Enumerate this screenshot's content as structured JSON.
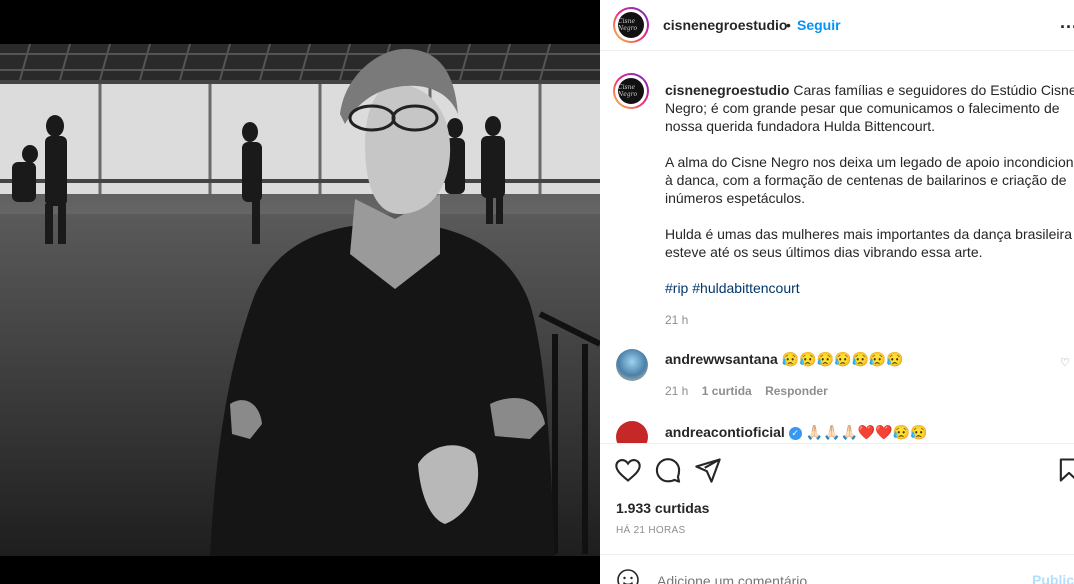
{
  "post": {
    "username": "cisnenegroestudio",
    "follow_label": "Seguir",
    "separator": "•",
    "more_label": "...",
    "avatar_text": "Cisne Negro",
    "caption_paragraphs": [
      "Caras famílias e seguidores do Estúdio Cisne Negro; é com grande pesar que comunicamos o falecimento de nossa querida fundadora Hulda Bittencourt.",
      "A alma do Cisne Negro nos deixa um legado de apoio incondicional à danca, com a formação de centenas de bailarinos e criação de inúmeros espetáculos.",
      "Hulda é umas das mulheres mais importantes da dança brasileira e esteve até os seus últimos dias vibrando essa arte."
    ],
    "hashtags": [
      "#rip",
      "#huldabittencourt"
    ],
    "caption_time": "21 h"
  },
  "comments": [
    {
      "username": "andrewwsantana",
      "text": "😥😥😥😥😥😥😥",
      "time": "21 h",
      "likes": "1 curtida",
      "reply": "Responder"
    },
    {
      "username": "andreacontioficial",
      "text": "🙏🏻🙏🏻🙏🏻❤️❤️😥😥",
      "verified": true
    }
  ],
  "footer": {
    "likes": "1.933 curtidas",
    "date": "HÁ 21 HORAS",
    "comment_placeholder": "Adicione um comentário...",
    "publish_label": "Publicar"
  },
  "colors": {
    "accent": "#0095f6",
    "hashtag": "#00376b",
    "muted": "#8e8e8e"
  }
}
